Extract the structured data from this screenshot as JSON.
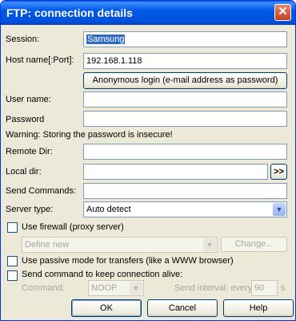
{
  "window": {
    "title": "FTP: connection details"
  },
  "fields": {
    "session": {
      "label": "Session:",
      "value": "Samsung"
    },
    "host": {
      "label": "Host name[:Port]:",
      "value": "192.168.1.118"
    },
    "anonymous_button": "Anonymous login (e-mail address as password)",
    "user": {
      "label": "User name:",
      "value": ""
    },
    "password": {
      "label": "Password",
      "value": ""
    },
    "warning": "Warning: Storing the password is insecure!",
    "remote_dir": {
      "label": "Remote Dir:",
      "value": ""
    },
    "local_dir": {
      "label": "Local dir:",
      "value": "",
      "browse": ">>"
    },
    "send_commands": {
      "label": "Send Commands:",
      "value": ""
    },
    "server_type": {
      "label": "Server type:",
      "value": "Auto detect"
    }
  },
  "firewall": {
    "label": "Use firewall (proxy server)",
    "checked": false,
    "select_value": "Define new",
    "change_button": "Change..."
  },
  "passive": {
    "label": "Use passive mode for transfers (like a WWW browser)",
    "checked": false
  },
  "keepalive": {
    "label": "Send command to keep connection alive:",
    "checked": false,
    "command_label": "Command:",
    "command_value": "NOOP",
    "interval_label": "Send interval: every",
    "interval_value": "90",
    "unit": "s"
  },
  "buttons": {
    "ok": "OK",
    "cancel": "Cancel",
    "help": "Help"
  }
}
